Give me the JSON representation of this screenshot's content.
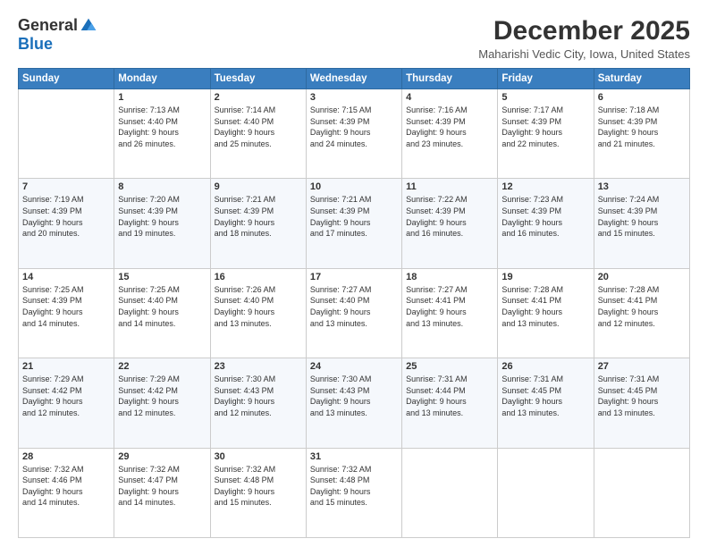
{
  "logo": {
    "general": "General",
    "blue": "Blue"
  },
  "header": {
    "month": "December 2025",
    "location": "Maharishi Vedic City, Iowa, United States"
  },
  "weekdays": [
    "Sunday",
    "Monday",
    "Tuesday",
    "Wednesday",
    "Thursday",
    "Friday",
    "Saturday"
  ],
  "weeks": [
    [
      {
        "day": "",
        "info": ""
      },
      {
        "day": "1",
        "info": "Sunrise: 7:13 AM\nSunset: 4:40 PM\nDaylight: 9 hours\nand 26 minutes."
      },
      {
        "day": "2",
        "info": "Sunrise: 7:14 AM\nSunset: 4:40 PM\nDaylight: 9 hours\nand 25 minutes."
      },
      {
        "day": "3",
        "info": "Sunrise: 7:15 AM\nSunset: 4:39 PM\nDaylight: 9 hours\nand 24 minutes."
      },
      {
        "day": "4",
        "info": "Sunrise: 7:16 AM\nSunset: 4:39 PM\nDaylight: 9 hours\nand 23 minutes."
      },
      {
        "day": "5",
        "info": "Sunrise: 7:17 AM\nSunset: 4:39 PM\nDaylight: 9 hours\nand 22 minutes."
      },
      {
        "day": "6",
        "info": "Sunrise: 7:18 AM\nSunset: 4:39 PM\nDaylight: 9 hours\nand 21 minutes."
      }
    ],
    [
      {
        "day": "7",
        "info": "Sunrise: 7:19 AM\nSunset: 4:39 PM\nDaylight: 9 hours\nand 20 minutes."
      },
      {
        "day": "8",
        "info": "Sunrise: 7:20 AM\nSunset: 4:39 PM\nDaylight: 9 hours\nand 19 minutes."
      },
      {
        "day": "9",
        "info": "Sunrise: 7:21 AM\nSunset: 4:39 PM\nDaylight: 9 hours\nand 18 minutes."
      },
      {
        "day": "10",
        "info": "Sunrise: 7:21 AM\nSunset: 4:39 PM\nDaylight: 9 hours\nand 17 minutes."
      },
      {
        "day": "11",
        "info": "Sunrise: 7:22 AM\nSunset: 4:39 PM\nDaylight: 9 hours\nand 16 minutes."
      },
      {
        "day": "12",
        "info": "Sunrise: 7:23 AM\nSunset: 4:39 PM\nDaylight: 9 hours\nand 16 minutes."
      },
      {
        "day": "13",
        "info": "Sunrise: 7:24 AM\nSunset: 4:39 PM\nDaylight: 9 hours\nand 15 minutes."
      }
    ],
    [
      {
        "day": "14",
        "info": "Sunrise: 7:25 AM\nSunset: 4:39 PM\nDaylight: 9 hours\nand 14 minutes."
      },
      {
        "day": "15",
        "info": "Sunrise: 7:25 AM\nSunset: 4:40 PM\nDaylight: 9 hours\nand 14 minutes."
      },
      {
        "day": "16",
        "info": "Sunrise: 7:26 AM\nSunset: 4:40 PM\nDaylight: 9 hours\nand 13 minutes."
      },
      {
        "day": "17",
        "info": "Sunrise: 7:27 AM\nSunset: 4:40 PM\nDaylight: 9 hours\nand 13 minutes."
      },
      {
        "day": "18",
        "info": "Sunrise: 7:27 AM\nSunset: 4:41 PM\nDaylight: 9 hours\nand 13 minutes."
      },
      {
        "day": "19",
        "info": "Sunrise: 7:28 AM\nSunset: 4:41 PM\nDaylight: 9 hours\nand 13 minutes."
      },
      {
        "day": "20",
        "info": "Sunrise: 7:28 AM\nSunset: 4:41 PM\nDaylight: 9 hours\nand 12 minutes."
      }
    ],
    [
      {
        "day": "21",
        "info": "Sunrise: 7:29 AM\nSunset: 4:42 PM\nDaylight: 9 hours\nand 12 minutes."
      },
      {
        "day": "22",
        "info": "Sunrise: 7:29 AM\nSunset: 4:42 PM\nDaylight: 9 hours\nand 12 minutes."
      },
      {
        "day": "23",
        "info": "Sunrise: 7:30 AM\nSunset: 4:43 PM\nDaylight: 9 hours\nand 12 minutes."
      },
      {
        "day": "24",
        "info": "Sunrise: 7:30 AM\nSunset: 4:43 PM\nDaylight: 9 hours\nand 13 minutes."
      },
      {
        "day": "25",
        "info": "Sunrise: 7:31 AM\nSunset: 4:44 PM\nDaylight: 9 hours\nand 13 minutes."
      },
      {
        "day": "26",
        "info": "Sunrise: 7:31 AM\nSunset: 4:45 PM\nDaylight: 9 hours\nand 13 minutes."
      },
      {
        "day": "27",
        "info": "Sunrise: 7:31 AM\nSunset: 4:45 PM\nDaylight: 9 hours\nand 13 minutes."
      }
    ],
    [
      {
        "day": "28",
        "info": "Sunrise: 7:32 AM\nSunset: 4:46 PM\nDaylight: 9 hours\nand 14 minutes."
      },
      {
        "day": "29",
        "info": "Sunrise: 7:32 AM\nSunset: 4:47 PM\nDaylight: 9 hours\nand 14 minutes."
      },
      {
        "day": "30",
        "info": "Sunrise: 7:32 AM\nSunset: 4:48 PM\nDaylight: 9 hours\nand 15 minutes."
      },
      {
        "day": "31",
        "info": "Sunrise: 7:32 AM\nSunset: 4:48 PM\nDaylight: 9 hours\nand 15 minutes."
      },
      {
        "day": "",
        "info": ""
      },
      {
        "day": "",
        "info": ""
      },
      {
        "day": "",
        "info": ""
      }
    ]
  ]
}
